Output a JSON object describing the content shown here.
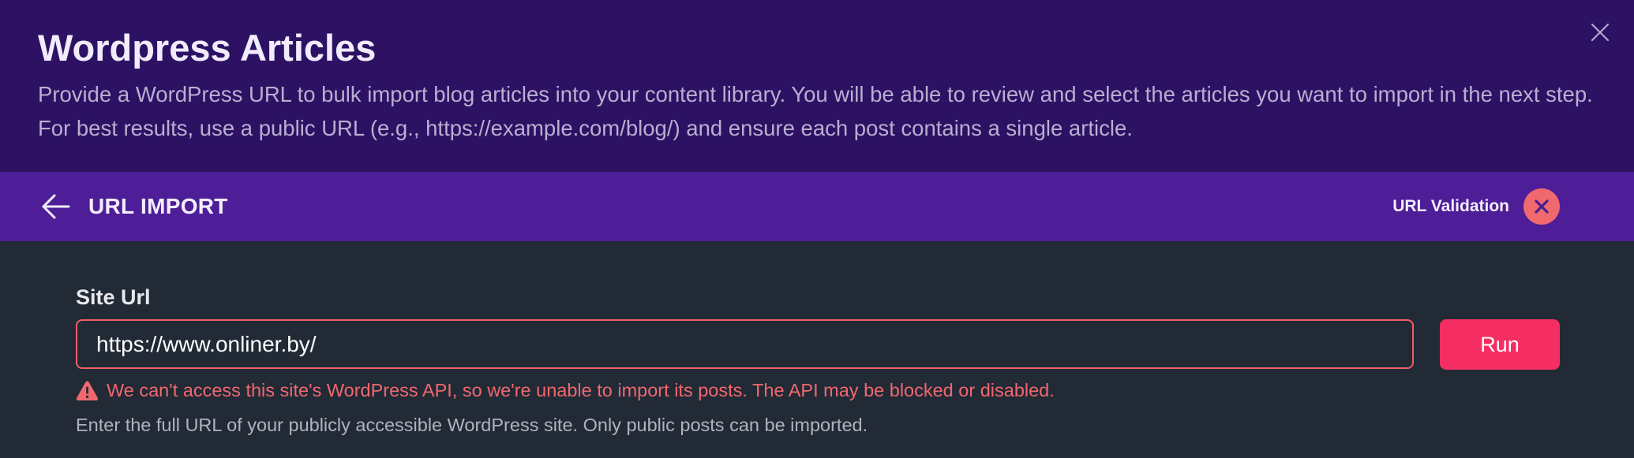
{
  "header": {
    "title": "Wordpress Articles",
    "description": "Provide a WordPress URL to bulk import blog articles into your content library. You will be able to review and select the articles you want to import in the next step. For best results, use a public URL (e.g., https://example.com/blog/) and ensure each post contains a single article.",
    "close_icon": "close-icon"
  },
  "toolbar": {
    "back_icon": "arrow-left-icon",
    "title": "URL IMPORT",
    "validation_label": "URL Validation",
    "validation_status": "failed",
    "validation_icon": "x-icon"
  },
  "form": {
    "label": "Site Url",
    "url_value": "https://www.onliner.by/",
    "run_label": "Run",
    "error_icon": "warning-triangle-icon",
    "error_message": "We can't access this site's WordPress API, so we're unable to import its posts. The API may be blocked or disabled.",
    "helper_text": "Enter the full URL of your publicly accessible WordPress site. Only public posts can be imported."
  },
  "colors": {
    "header_bg": "#2d1264",
    "toolbar_bg": "#4e1e98",
    "content_bg": "#222a36",
    "error": "#f0686e",
    "run_button": "#f42e63",
    "validation_badge": "#f0696f"
  }
}
